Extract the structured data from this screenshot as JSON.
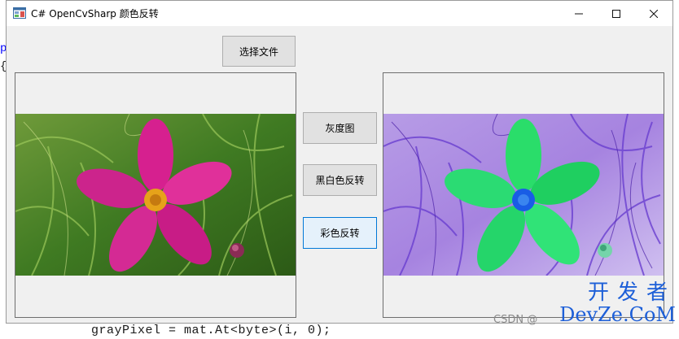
{
  "background_code": {
    "left_line_1": "p",
    "left_line_2": "{",
    "bottom_line": "grayPixel = mat.At<byte>(i, 0);"
  },
  "window": {
    "title": "C# OpenCvSharp 颜色反转",
    "controls": {
      "minimize": "—",
      "maximize": "☐",
      "close": "✕"
    }
  },
  "buttons": {
    "select_file": "选择文件",
    "grayscale": "灰度图",
    "bw_invert": "黑白色反转",
    "color_invert": "彩色反转"
  },
  "watermark": {
    "cn": "开发者",
    "en": "DevZe.CoM",
    "csdn": "CSDN @"
  },
  "colors": {
    "accent": "#0078d7",
    "watermark": "#1d5fd8"
  }
}
